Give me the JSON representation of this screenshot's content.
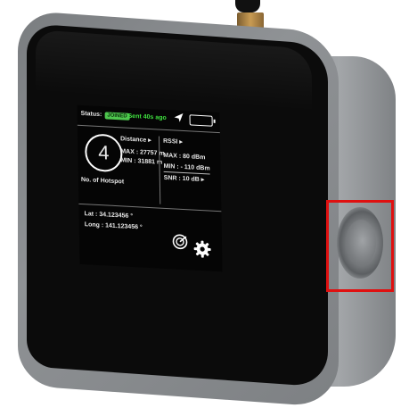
{
  "device": {
    "status_label": "Status:",
    "status_badge": "JOINED",
    "last_sent": "Sent 40s ago",
    "hotspot_count": "4",
    "hotspot_label": "No. of Hotspot",
    "distance": {
      "label": "Distance ▸",
      "max": "MAX : 27757 m",
      "min": "MIN : 31881 m"
    },
    "rssi": {
      "label": "RSSI ▸",
      "max": "MAX :     80 dBm",
      "min": "MIN :  - 110 dBm"
    },
    "snr": "SNR  :   10 dB ▸",
    "lat": "Lat    :   34.123456 °",
    "long": "Long :  141.123456 °"
  },
  "icons": [
    "navigation-arrow-icon",
    "battery-icon",
    "radar-icon",
    "gear-icon",
    "side-port-icon"
  ],
  "colors": {
    "badge": "#4ec64e",
    "sent_text": "#3fe23f",
    "highlight": "#e01010",
    "body": "#8d9093"
  }
}
